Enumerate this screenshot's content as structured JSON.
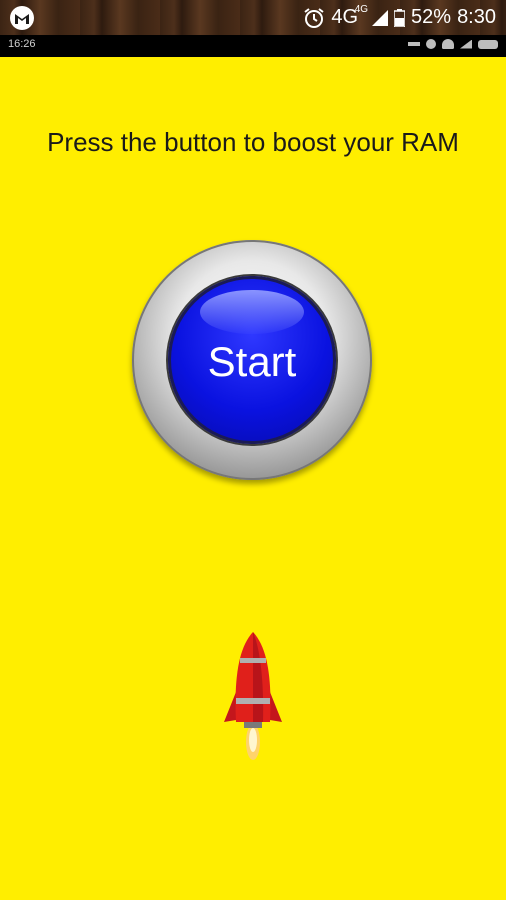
{
  "device_status": {
    "network": "4G",
    "network_sup": "4G",
    "battery": "52%",
    "time": "8:30"
  },
  "app_status": {
    "time": "16:26"
  },
  "main": {
    "prompt": "Press the button to boost your RAM",
    "start_label": "Start"
  },
  "colors": {
    "background": "#ffee00",
    "button_blue": "#0a12e0",
    "rocket_red": "#e0201b"
  },
  "icons": [
    "malwarebytes-logo-icon",
    "alarm-icon",
    "signal-icon",
    "battery-icon",
    "rocket-icon"
  ]
}
